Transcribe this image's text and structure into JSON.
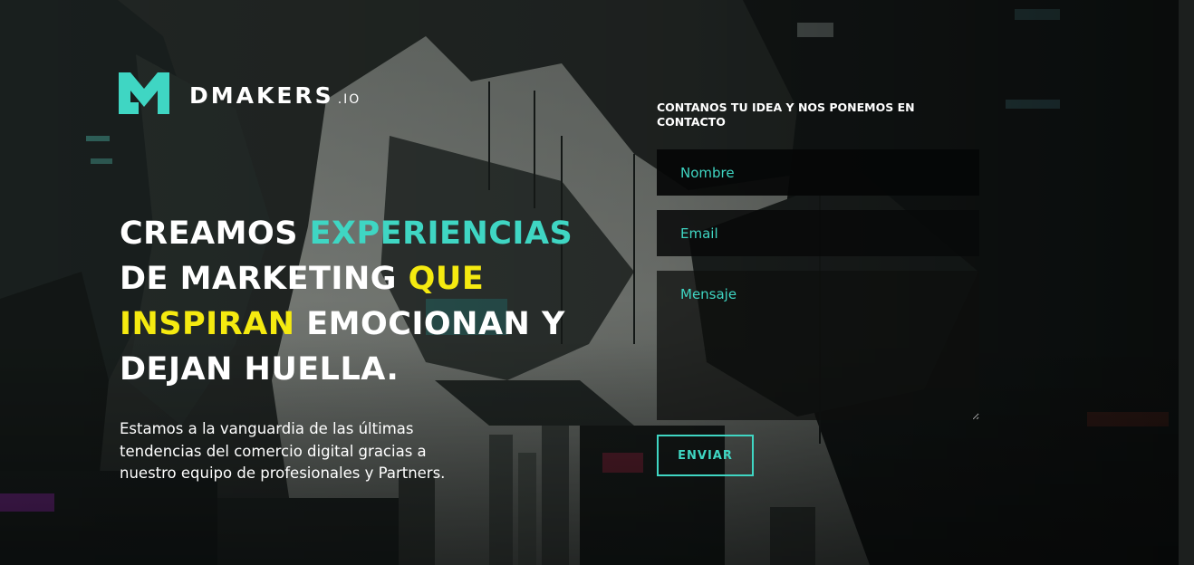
{
  "brand": {
    "name": "DMAKERS",
    "tld": ".IO",
    "accent_color": "#3fd6c3",
    "highlight_color": "#f5ea10"
  },
  "hero": {
    "headline": {
      "part1": "CREAMOS ",
      "part2": "EXPERIENCIAS",
      "part3": " DE MARKETING ",
      "part4": "QUE INSPIRAN",
      "part5": " EMOCIONAN Y DEJAN HUELLA."
    },
    "subtext": "Estamos a la vanguardia de las últimas tendencias del comercio digital gracias a nuestro equipo de profesionales y Partners."
  },
  "contact_form": {
    "title": "CONTANOS TU IDEA Y NOS PONEMOS EN CONTACTO",
    "name_placeholder": "Nombre",
    "email_placeholder": "Email",
    "message_placeholder": "Mensaje",
    "submit_label": "ENVIAR"
  },
  "icons": {
    "logo": "dm-logo-mark",
    "background": "dystopian-city-illustration"
  }
}
